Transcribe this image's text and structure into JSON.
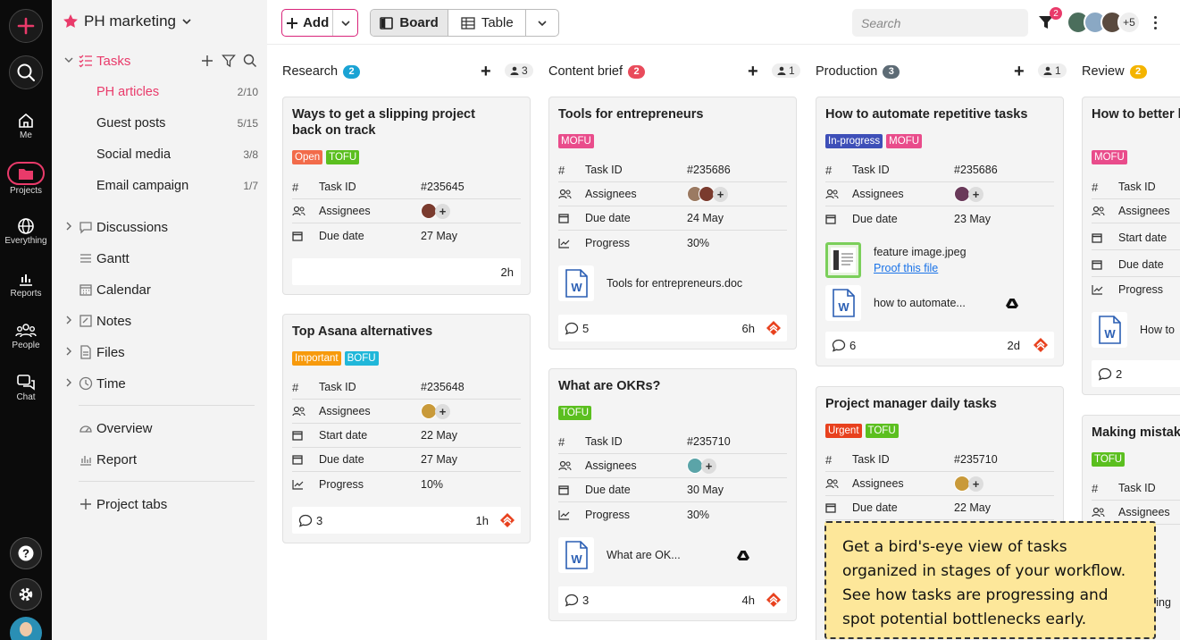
{
  "rail": {
    "add_icon": "plus-icon",
    "items": [
      {
        "label": "Me",
        "icon": "home-icon"
      },
      {
        "label": "Projects",
        "icon": "folder-icon"
      },
      {
        "label": "Everything",
        "icon": "globe-icon"
      },
      {
        "label": "Reports",
        "icon": "chart-icon"
      },
      {
        "label": "People",
        "icon": "people-icon"
      },
      {
        "label": "Chat",
        "icon": "chat-icon"
      }
    ]
  },
  "sidebar": {
    "project": "PH marketing",
    "tasks_label": "Tasks",
    "subitems": [
      {
        "label": "PH articles",
        "count": "2/10"
      },
      {
        "label": "Guest posts",
        "count": "5/15"
      },
      {
        "label": "Social media",
        "count": "3/8"
      },
      {
        "label": "Email campaign",
        "count": "1/7"
      }
    ],
    "items": [
      {
        "label": "Discussions"
      },
      {
        "label": "Gantt"
      },
      {
        "label": "Calendar"
      },
      {
        "label": "Notes"
      },
      {
        "label": "Files"
      },
      {
        "label": "Time"
      },
      {
        "label": "Overview"
      },
      {
        "label": "Report"
      },
      {
        "label": "Project tabs"
      }
    ]
  },
  "top": {
    "add": "Add",
    "board": "Board",
    "table": "Table",
    "search_placeholder": "Search",
    "filter_count": "2",
    "more_count": "+5"
  },
  "columns": [
    {
      "name": "Research",
      "count": "2",
      "members": "3",
      "color": "#1aa3d4"
    },
    {
      "name": "Content brief",
      "count": "2",
      "members": "1",
      "color": "#e94b5b"
    },
    {
      "name": "Production",
      "count": "3",
      "members": "1",
      "color": "#5d6b75"
    },
    {
      "name": "Review",
      "count": "2",
      "color": "#f4b400"
    }
  ],
  "labels": {
    "task_id": "Task ID",
    "assignees": "Assignees",
    "due": "Due date",
    "start": "Start date",
    "progress": "Progress",
    "proof": "Proof this file"
  },
  "cards": {
    "c1": {
      "title": "Ways to get a slipping project back on track",
      "tags": [
        "Open",
        "TOFU"
      ],
      "id": "#235645",
      "due": "27 May",
      "time": "2h"
    },
    "c2": {
      "title": "Top Asana alternatives",
      "tags": [
        "Important",
        "BOFU"
      ],
      "id": "#235648",
      "start": "22 May",
      "due": "27 May",
      "progress": "10%",
      "comments": "3",
      "time": "1h"
    },
    "c3": {
      "title": "Tools for entrepreneurs",
      "tags": [
        "MOFU"
      ],
      "id": "#235686",
      "due": "24 May",
      "progress": "30%",
      "file": "Tools for entrepreneurs.doc",
      "comments": "5",
      "time": "6h"
    },
    "c4": {
      "title": "What are OKRs?",
      "tags": [
        "TOFU"
      ],
      "id": "#235710",
      "due": "30 May",
      "progress": "30%",
      "file": "What are OK...",
      "comments": "3",
      "time": "4h"
    },
    "c5": {
      "title": "How to automate repetitive tasks",
      "tags": [
        "In-progress",
        "MOFU"
      ],
      "id": "#235686",
      "due": "23 May",
      "file1": "feature image.jpeg",
      "file2": "how to automate...",
      "comments": "6",
      "time": "2d"
    },
    "c6": {
      "title": "Project manager daily tasks",
      "tags": [
        "Urgent",
        "TOFU"
      ],
      "id": "#235710",
      "due": "22 May"
    },
    "c7": {
      "title": "How to better h deadlines as a",
      "tags": [
        "MOFU"
      ],
      "file": "How to",
      "comments": "2"
    },
    "c8": {
      "title": "Making mistak",
      "tags": [
        "TOFU"
      ],
      "bottom_text": "king"
    }
  },
  "tag_colors": {
    "Open": "#f26b4a",
    "TOFU": "#5bbf1f",
    "Important": "#f79a0c",
    "BOFU": "#20b7d9",
    "MOFU": "#e94c8b",
    "In-progress": "#3e4fb8",
    "Urgent": "#e8411e"
  },
  "tooltip": "Get a bird's-eye view of tasks organized in stages of your workflow. See how tasks are progressing and spot potential bottlenecks early."
}
